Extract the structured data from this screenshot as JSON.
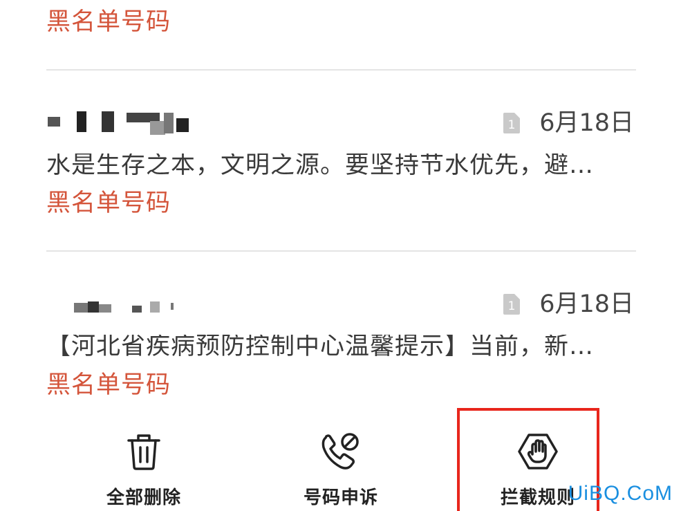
{
  "top_partial": {
    "tag": "黑名单号码"
  },
  "messages": [
    {
      "date": "6月18日",
      "preview": "水是生存之本，文明之源。要坚持节水优先，避…",
      "tag": "黑名单号码",
      "sim_icon": "sim-card-1-icon"
    },
    {
      "date": "6月18日",
      "preview": "【河北省疾病预防控制中心温馨提示】当前，新…",
      "tag": "黑名单号码",
      "sim_icon": "sim-card-1-icon"
    }
  ],
  "toolbar": {
    "delete_all_label": "全部删除",
    "appeal_label": "号码申诉",
    "block_rules_label": "拦截规则"
  },
  "watermark": "UiBQ.CoM",
  "colors": {
    "tag": "#d4553b",
    "highlight": "#e8261c",
    "watermark": "#1a8fe0"
  }
}
